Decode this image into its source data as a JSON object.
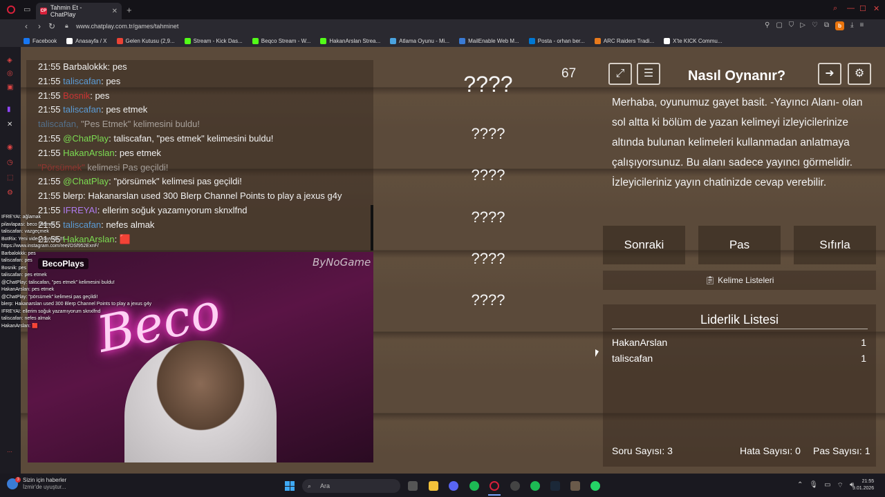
{
  "browser": {
    "tab_title": "Tahmin Et - ChatPlay",
    "tab_favicon": "CP",
    "url": "www.chatplay.com.tr/games/tahminet",
    "profile_initial": "b"
  },
  "bookmarks": [
    {
      "label": "Facebook",
      "icon": "facebook-icon",
      "color": "#1877f2"
    },
    {
      "label": "Anasayfa / X",
      "icon": "x-icon",
      "color": "#ffffff"
    },
    {
      "label": "Gelen Kutusu (2,9...",
      "icon": "gmail-icon",
      "color": "#ea4335"
    },
    {
      "label": "Stream - Kick Das...",
      "icon": "kick-icon",
      "color": "#53fc18"
    },
    {
      "label": "Beqco Stream - W...",
      "icon": "kick-icon",
      "color": "#53fc18"
    },
    {
      "label": "HakanArslan Strea...",
      "icon": "kick-icon",
      "color": "#53fc18"
    },
    {
      "label": "Atlama Oyunu - Mi...",
      "icon": "game-icon",
      "color": "#4aa3df"
    },
    {
      "label": "MailEnable Web M...",
      "icon": "mail-icon",
      "color": "#3a7bd5"
    },
    {
      "label": "Posta - orhan ber...",
      "icon": "outlook-icon",
      "color": "#0078d4"
    },
    {
      "label": "ARC Raiders Tradi...",
      "icon": "arc-icon",
      "color": "#e87a1c"
    },
    {
      "label": "X'te KICK Commu...",
      "icon": "x-icon",
      "color": "#ffffff"
    }
  ],
  "stream_chat": [
    {
      "time": "21:55",
      "user": "Barbalokkk",
      "msg": "pes",
      "color": "#f2f2f2"
    },
    {
      "time": "21:55",
      "user": "taliscafan",
      "msg": "pes",
      "color": "#5b9bd5"
    },
    {
      "time": "21:55",
      "user": "Bosnik",
      "msg": "pes",
      "color": "#c33"
    },
    {
      "time": "21:55",
      "user": "taliscafan",
      "msg": "pes etmek",
      "color": "#5b9bd5"
    },
    {
      "time": "",
      "user": "taliscafan,",
      "msg": "\"Pes Etmek\" kelimesini buldu!",
      "color": "#5b9bd5",
      "faded": true
    },
    {
      "time": "21:55",
      "user": "@ChatPlay",
      "msg": "taliscafan, \"pes etmek\" kelimesini buldu!",
      "color": "#7cdc52"
    },
    {
      "time": "21:55",
      "user": "HakanArslan",
      "msg": "pes etmek",
      "color": "#7cdc52"
    },
    {
      "time": "",
      "user": "\"Pörsümek\"",
      "msg": "kelimesi Pas geçildi!",
      "color": "#c33",
      "faded": true
    },
    {
      "time": "21:55",
      "user": "@ChatPlay",
      "msg": "\"pörsümek\" kelimesi pas geçildi!",
      "color": "#7cdc52"
    },
    {
      "time": "21:55",
      "user": "blerp",
      "msg": "Hakanarslan used 300 Blerp Channel Points to play a jexus g4y",
      "color": "#f2f2f2"
    },
    {
      "time": "21:55",
      "user": "IFREYAI",
      "msg": "ellerim soğuk yazamıyorum sknxlfnd",
      "color": "#b07cf0"
    },
    {
      "time": "21:55",
      "user": "taliscafan",
      "msg": "nefes almak",
      "color": "#5b9bd5"
    },
    {
      "time": "21:55",
      "user": "HakanArslan",
      "msg": "🟥",
      "color": "#7cdc52"
    }
  ],
  "stream_overlay": {
    "channel_tag": "BecoPlays",
    "watermark": "ByNoGame",
    "neon_sign": "Beco",
    "lines": [
      "IFREYAI: ağlamak",
      "pilavlapasi: beco izlemek",
      "taliscafan: vazgeçmek",
      "BotRix: Yeni video yayında !!!",
      "https://www.instagram.com/reel/DSf952ExnF/",
      "Barbalokkk: pes",
      "taliscafan: pes",
      "Bosnik: pes",
      "taliscafan: pes etmek",
      "@ChatPlay: taliscafan, \"pes etmek\" kelimesini buldu!",
      "HakanArslan: pes etmek",
      "@ChatPlay: \"pörsümek\" kelimesi pas geçildi!",
      "blerp: Hakanarslan used 300 Blerp Channel Points to play a jexus g4y",
      "IFREYAI: ellerim soğuk yazamıyorum sknxlfnd",
      "taliscafan: nefes almak",
      "HakanArslan: 🟥"
    ]
  },
  "game": {
    "counter": "67",
    "words": [
      "????",
      "????",
      "????",
      "????",
      "????",
      "????"
    ],
    "how_title": "Nasıl Oynanır?",
    "how_text": "Merhaba, oyunumuz gayet basit. -Yayıncı Alanı- olan sol altta ki bölüm de yazan kelimeyi izleyicilerinize altında bulunan kelimeleri kullanmadan anlatmaya çalışıyorsunuz. Bu alanı sadece yayıncı görmelidir. İzleyicileriniz yayın chatinizde cevap verebilir.",
    "buttons": {
      "next": "Sonraki",
      "pass": "Pas",
      "reset": "Sıfırla"
    },
    "word_list_label": "Kelime Listeleri",
    "leaderboard": {
      "title": "Liderlik Listesi",
      "rows": [
        {
          "name": "HakanArslan",
          "score": "1"
        },
        {
          "name": "taliscafan",
          "score": "1"
        }
      ]
    },
    "stats": {
      "questions": "Soru Sayısı: 3",
      "errors": "Hata Sayısı: 0",
      "passes": "Pas Sayısı: 1"
    }
  },
  "taskbar": {
    "news_title": "Sizin için haberler",
    "news_sub": "İzmir'de uyuştur...",
    "news_badge": "3",
    "search_placeholder": "Ara",
    "time": "21:55",
    "date": "9.01.2026"
  }
}
